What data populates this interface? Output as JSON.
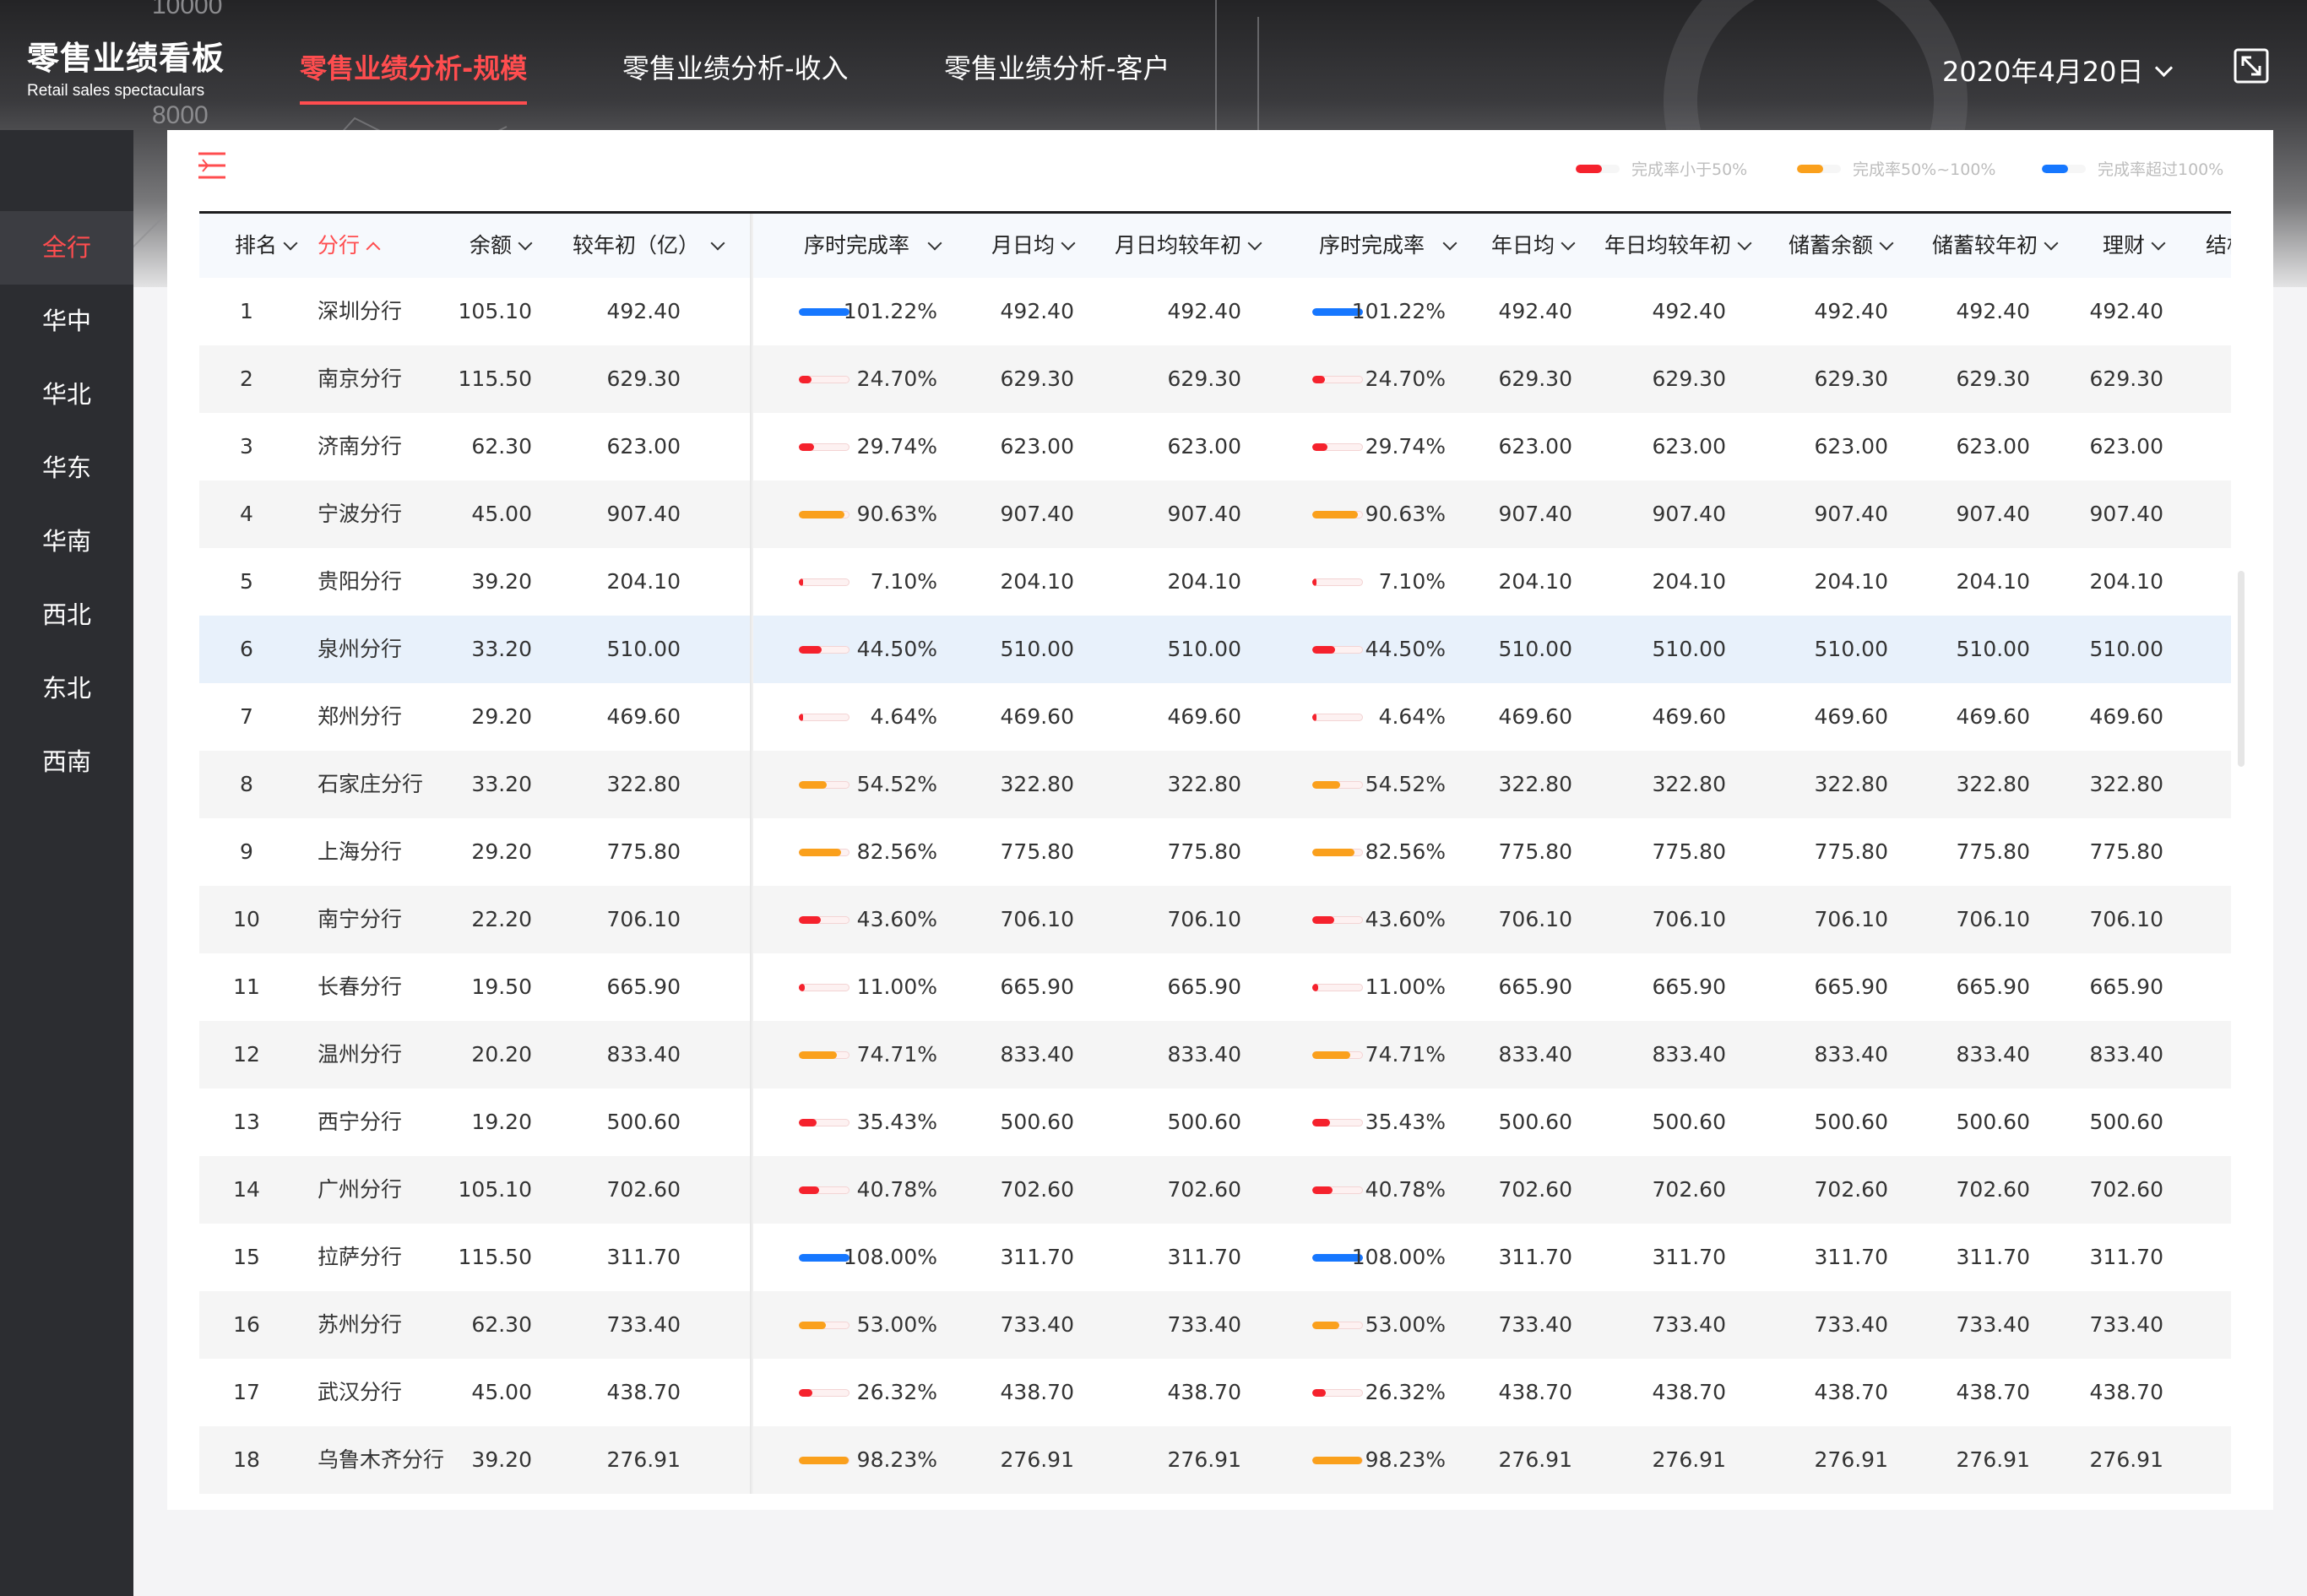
{
  "app": {
    "title": "零售业绩看板",
    "subtitle": "Retail sales spectaculars"
  },
  "nav": {
    "tabs": [
      {
        "label": "零售业绩分析-规模",
        "active": true
      },
      {
        "label": "零售业绩分析-收入",
        "active": false
      },
      {
        "label": "零售业绩分析-客户",
        "active": false
      }
    ]
  },
  "date": {
    "value": "2020年4月20日"
  },
  "banner_decor": {
    "numbers": [
      "10000",
      "8000"
    ]
  },
  "sidebar": {
    "items": [
      {
        "label": "全行",
        "active": true
      },
      {
        "label": "华中"
      },
      {
        "label": "华北"
      },
      {
        "label": "华东"
      },
      {
        "label": "华南"
      },
      {
        "label": "西北"
      },
      {
        "label": "东北"
      },
      {
        "label": "西南"
      }
    ]
  },
  "legend": [
    {
      "label": "完成率小于50%",
      "color": "#f5222d"
    },
    {
      "label": "完成率50%~100%",
      "color": "#faa01c"
    },
    {
      "label": "完成率超过100%",
      "color": "#1677ff"
    }
  ],
  "colors": {
    "accent": "#ff4d4f",
    "low": "#f5222d",
    "mid": "#faa01c",
    "high": "#1677ff"
  },
  "table": {
    "columns": [
      "排名",
      "分行",
      "余额",
      "较年初（亿）",
      "序时完成率",
      "月日均",
      "月日均较年初",
      "序时完成率",
      "年日均",
      "年日均较年初",
      "储蓄余额",
      "储蓄较年初",
      "理财",
      "结构"
    ],
    "rows": [
      {
        "rank": "1",
        "branch": "深圳分行",
        "balance": "105.10",
        "ytd": "492.40",
        "rate": "101.22%",
        "rate_value": 101.22,
        "values": [
          "492.40",
          "492.40",
          "492.40",
          "492.40",
          "492.40",
          "492.40",
          "492.40"
        ]
      },
      {
        "rank": "2",
        "branch": "南京分行",
        "balance": "115.50",
        "ytd": "629.30",
        "rate": "24.70%",
        "rate_value": 24.7,
        "values": [
          "629.30",
          "629.30",
          "629.30",
          "629.30",
          "629.30",
          "629.30",
          "629.30"
        ]
      },
      {
        "rank": "3",
        "branch": "济南分行",
        "balance": "62.30",
        "ytd": "623.00",
        "rate": "29.74%",
        "rate_value": 29.74,
        "values": [
          "623.00",
          "623.00",
          "623.00",
          "623.00",
          "623.00",
          "623.00",
          "623.00"
        ]
      },
      {
        "rank": "4",
        "branch": "宁波分行",
        "balance": "45.00",
        "ytd": "907.40",
        "rate": "90.63%",
        "rate_value": 90.63,
        "values": [
          "907.40",
          "907.40",
          "907.40",
          "907.40",
          "907.40",
          "907.40",
          "907.40"
        ]
      },
      {
        "rank": "5",
        "branch": "贵阳分行",
        "balance": "39.20",
        "ytd": "204.10",
        "rate": "7.10%",
        "rate_value": 7.1,
        "values": [
          "204.10",
          "204.10",
          "204.10",
          "204.10",
          "204.10",
          "204.10",
          "204.10"
        ]
      },
      {
        "rank": "6",
        "branch": "泉州分行",
        "balance": "33.20",
        "ytd": "510.00",
        "rate": "44.50%",
        "rate_value": 44.5,
        "selected": true,
        "values": [
          "510.00",
          "510.00",
          "510.00",
          "510.00",
          "510.00",
          "510.00",
          "510.00"
        ]
      },
      {
        "rank": "7",
        "branch": "郑州分行",
        "balance": "29.20",
        "ytd": "469.60",
        "rate": "4.64%",
        "rate_value": 4.64,
        "values": [
          "469.60",
          "469.60",
          "469.60",
          "469.60",
          "469.60",
          "469.60",
          "469.60"
        ]
      },
      {
        "rank": "8",
        "branch": "石家庄分行",
        "balance": "33.20",
        "ytd": "322.80",
        "rate": "54.52%",
        "rate_value": 54.52,
        "values": [
          "322.80",
          "322.80",
          "322.80",
          "322.80",
          "322.80",
          "322.80",
          "322.80"
        ]
      },
      {
        "rank": "9",
        "branch": "上海分行",
        "balance": "29.20",
        "ytd": "775.80",
        "rate": "82.56%",
        "rate_value": 82.56,
        "values": [
          "775.80",
          "775.80",
          "775.80",
          "775.80",
          "775.80",
          "775.80",
          "775.80"
        ]
      },
      {
        "rank": "10",
        "branch": "南宁分行",
        "balance": "22.20",
        "ytd": "706.10",
        "rate": "43.60%",
        "rate_value": 43.6,
        "values": [
          "706.10",
          "706.10",
          "706.10",
          "706.10",
          "706.10",
          "706.10",
          "706.10"
        ]
      },
      {
        "rank": "11",
        "branch": "长春分行",
        "balance": "19.50",
        "ytd": "665.90",
        "rate": "11.00%",
        "rate_value": 11.0,
        "values": [
          "665.90",
          "665.90",
          "665.90",
          "665.90",
          "665.90",
          "665.90",
          "665.90"
        ]
      },
      {
        "rank": "12",
        "branch": "温州分行",
        "balance": "20.20",
        "ytd": "833.40",
        "rate": "74.71%",
        "rate_value": 74.71,
        "values": [
          "833.40",
          "833.40",
          "833.40",
          "833.40",
          "833.40",
          "833.40",
          "833.40"
        ]
      },
      {
        "rank": "13",
        "branch": "西宁分行",
        "balance": "19.20",
        "ytd": "500.60",
        "rate": "35.43%",
        "rate_value": 35.43,
        "values": [
          "500.60",
          "500.60",
          "500.60",
          "500.60",
          "500.60",
          "500.60",
          "500.60"
        ]
      },
      {
        "rank": "14",
        "branch": "广州分行",
        "balance": "105.10",
        "ytd": "702.60",
        "rate": "40.78%",
        "rate_value": 40.78,
        "values": [
          "702.60",
          "702.60",
          "702.60",
          "702.60",
          "702.60",
          "702.60",
          "702.60"
        ]
      },
      {
        "rank": "15",
        "branch": "拉萨分行",
        "balance": "115.50",
        "ytd": "311.70",
        "rate": "108.00%",
        "rate_value": 108.0,
        "values": [
          "311.70",
          "311.70",
          "311.70",
          "311.70",
          "311.70",
          "311.70",
          "311.70"
        ]
      },
      {
        "rank": "16",
        "branch": "苏州分行",
        "balance": "62.30",
        "ytd": "733.40",
        "rate": "53.00%",
        "rate_value": 53.0,
        "values": [
          "733.40",
          "733.40",
          "733.40",
          "733.40",
          "733.40",
          "733.40",
          "733.40"
        ]
      },
      {
        "rank": "17",
        "branch": "武汉分行",
        "balance": "45.00",
        "ytd": "438.70",
        "rate": "26.32%",
        "rate_value": 26.32,
        "values": [
          "438.70",
          "438.70",
          "438.70",
          "438.70",
          "438.70",
          "438.70",
          "438.70"
        ]
      },
      {
        "rank": "18",
        "branch": "乌鲁木齐分行",
        "balance": "39.20",
        "ytd": "276.91",
        "rate": "98.23%",
        "rate_value": 98.23,
        "values": [
          "276.91",
          "276.91",
          "276.91",
          "276.91",
          "276.91",
          "276.91",
          "276.91"
        ]
      }
    ]
  }
}
